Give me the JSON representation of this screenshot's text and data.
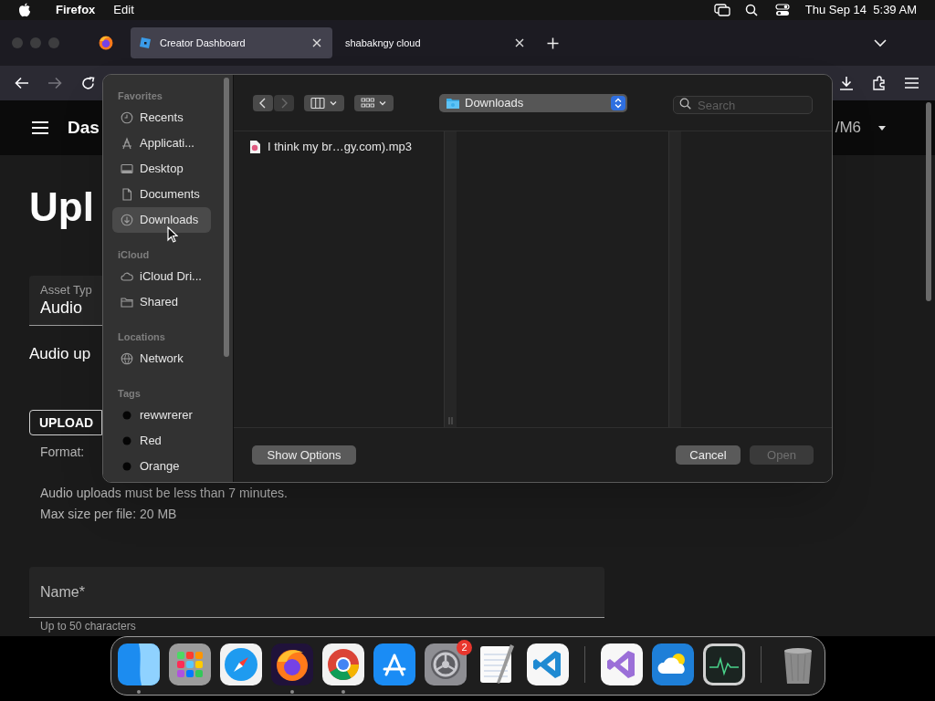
{
  "menu_bar": {
    "app": "Firefox",
    "items": [
      "Edit"
    ],
    "clock": "Thu Sep 14  5:39 AM"
  },
  "tabs": [
    {
      "title": "Creator Dashboard",
      "selected": true
    },
    {
      "title": "shabakngy cloud",
      "selected": false
    }
  ],
  "page": {
    "header_title": "Das",
    "account": "/M6",
    "heading": "Upl",
    "asset_type": {
      "label": "Asset Typ",
      "value": "Audio"
    },
    "audio_note": "Audio up",
    "upload_button": "UPLOAD",
    "format": "Format:",
    "limits": [
      "Audio uploads must be less than 7 minutes.",
      "Max size per file: 20 MB"
    ],
    "name_field": {
      "placeholder": "Name*"
    },
    "name_hint": "Up to 50 characters"
  },
  "dialog": {
    "sidebar": [
      {
        "heading": "Favorites",
        "items": [
          {
            "label": "Recents",
            "kind": "clock",
            "selected": false
          },
          {
            "label": "Applicati...",
            "kind": "apps",
            "selected": false
          },
          {
            "label": "Desktop",
            "kind": "desktop",
            "selected": false
          },
          {
            "label": "Documents",
            "kind": "document",
            "selected": false
          },
          {
            "label": "Downloads",
            "kind": "download",
            "selected": true
          }
        ]
      },
      {
        "heading": "iCloud",
        "items": [
          {
            "label": "iCloud Dri...",
            "kind": "cloud",
            "selected": false
          },
          {
            "label": "Shared",
            "kind": "folder",
            "selected": false
          }
        ]
      },
      {
        "heading": "Locations",
        "items": [
          {
            "label": "Network",
            "kind": "globe",
            "selected": false
          }
        ]
      },
      {
        "heading": "Tags",
        "items": [
          {
            "label": "rewwrerer",
            "kind": "tag",
            "selected": false
          },
          {
            "label": "Red",
            "kind": "tag",
            "selected": false
          },
          {
            "label": "Orange",
            "kind": "tag",
            "selected": false
          }
        ]
      }
    ],
    "location": "Downloads",
    "search": {
      "placeholder": "Search"
    },
    "files": [
      {
        "name": "I think my br…gy.com).mp3"
      }
    ],
    "show_options": "Show Options",
    "cancel": "Cancel",
    "open": {
      "label": "Open",
      "disabled": true
    }
  },
  "dock": [
    {
      "kind": "finder",
      "running": true
    },
    {
      "kind": "launchpad",
      "running": false
    },
    {
      "kind": "safari",
      "running": false
    },
    {
      "kind": "firefox",
      "running": true
    },
    {
      "kind": "chrome",
      "running": true
    },
    {
      "kind": "appstore",
      "running": false
    },
    {
      "kind": "settings",
      "running": false,
      "badge": "2"
    },
    {
      "kind": "textedit",
      "running": false
    },
    {
      "kind": "vscode",
      "running": false
    },
    {
      "kind": "separator"
    },
    {
      "kind": "vstudio",
      "running": false
    },
    {
      "kind": "weather",
      "running": false
    },
    {
      "kind": "activity",
      "running": false
    },
    {
      "kind": "separator"
    },
    {
      "kind": "trash",
      "running": false
    }
  ]
}
